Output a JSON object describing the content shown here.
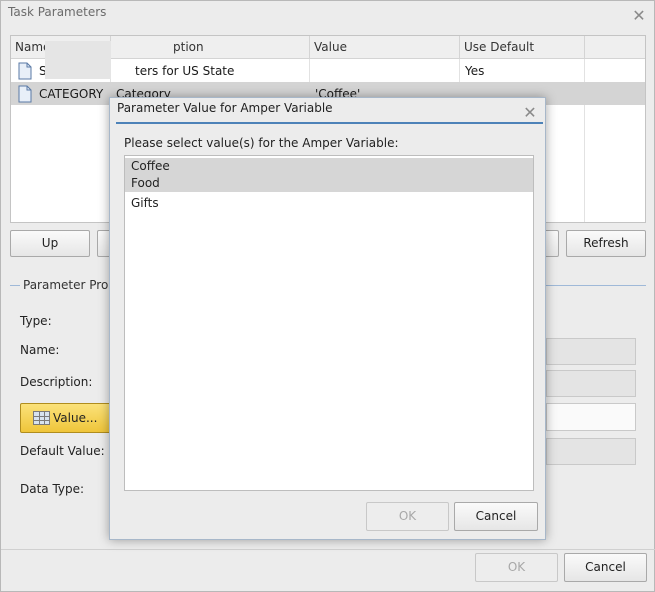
{
  "window": {
    "title": "Task Parameters"
  },
  "grid": {
    "columns": [
      "Name",
      "ption",
      "Value",
      "Use Default"
    ],
    "rows": [
      {
        "name": "S",
        "description": "ters for US State",
        "value": "",
        "use_default": "Yes"
      },
      {
        "name": "CATEGORY",
        "description": "Category",
        "value": "'Coffee'",
        "use_default": ""
      }
    ]
  },
  "buttons": {
    "up": "Up",
    "refresh": "Refresh",
    "ok": "OK",
    "cancel": "Cancel"
  },
  "properties": {
    "group_label": "Parameter Prop",
    "type_label": "Type:",
    "name_label": "Name:",
    "description_label": "Description:",
    "value_button": "Value...",
    "default_value_label": "Default Value:",
    "data_type_label": "Data Type:"
  },
  "modal": {
    "title": "Parameter Value for Amper Variable",
    "prompt": "Please select value(s) for the Amper Variable:",
    "options": [
      {
        "label": "Coffee",
        "selected": true
      },
      {
        "label": "Food",
        "selected": true
      },
      {
        "label": "Gifts",
        "selected": false
      }
    ],
    "ok": "OK",
    "cancel": "Cancel"
  },
  "icons": {
    "close": "close-icon",
    "document": "document-icon",
    "table": "table-icon"
  }
}
